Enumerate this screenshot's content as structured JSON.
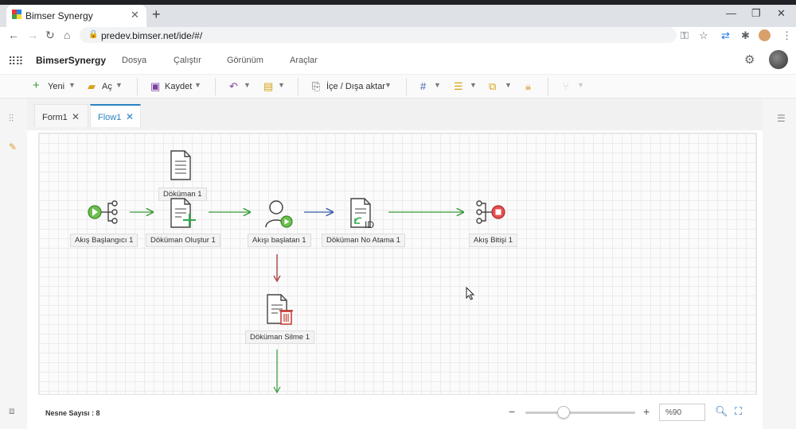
{
  "browser": {
    "tab_title": "Bimser Synergy",
    "url": "predev.bimser.net/ide/#/"
  },
  "app": {
    "brand": "BimserSynergy",
    "menu": [
      "Dosya",
      "Çalıştır",
      "Görünüm",
      "Araçlar"
    ]
  },
  "toolbar": {
    "new_label": "Yeni",
    "open_label": "Aç",
    "save_label": "Kaydet",
    "import_export_label": "İçe / Dışa aktar"
  },
  "tabs": [
    {
      "label": "Form1",
      "active": false
    },
    {
      "label": "Flow1",
      "active": true
    }
  ],
  "nodes": {
    "doc1": "Döküman 1",
    "start": "Akış Başlangıcı 1",
    "create": "Döküman Oluştur 1",
    "initiator": "Akışı başlatan 1",
    "numbering": "Döküman No Atama 1",
    "end": "Akış Bitişi 1",
    "delete": "Döküman Silme 1"
  },
  "status": {
    "count_text": "Nesne Sayısı : 8",
    "zoom_value": "%90",
    "zoom_fraction": 0.35
  },
  "colors": {
    "accent": "#2b82c3",
    "green": "#3a9a3a",
    "red": "#c0392b",
    "blue": "#3b5ba8"
  }
}
